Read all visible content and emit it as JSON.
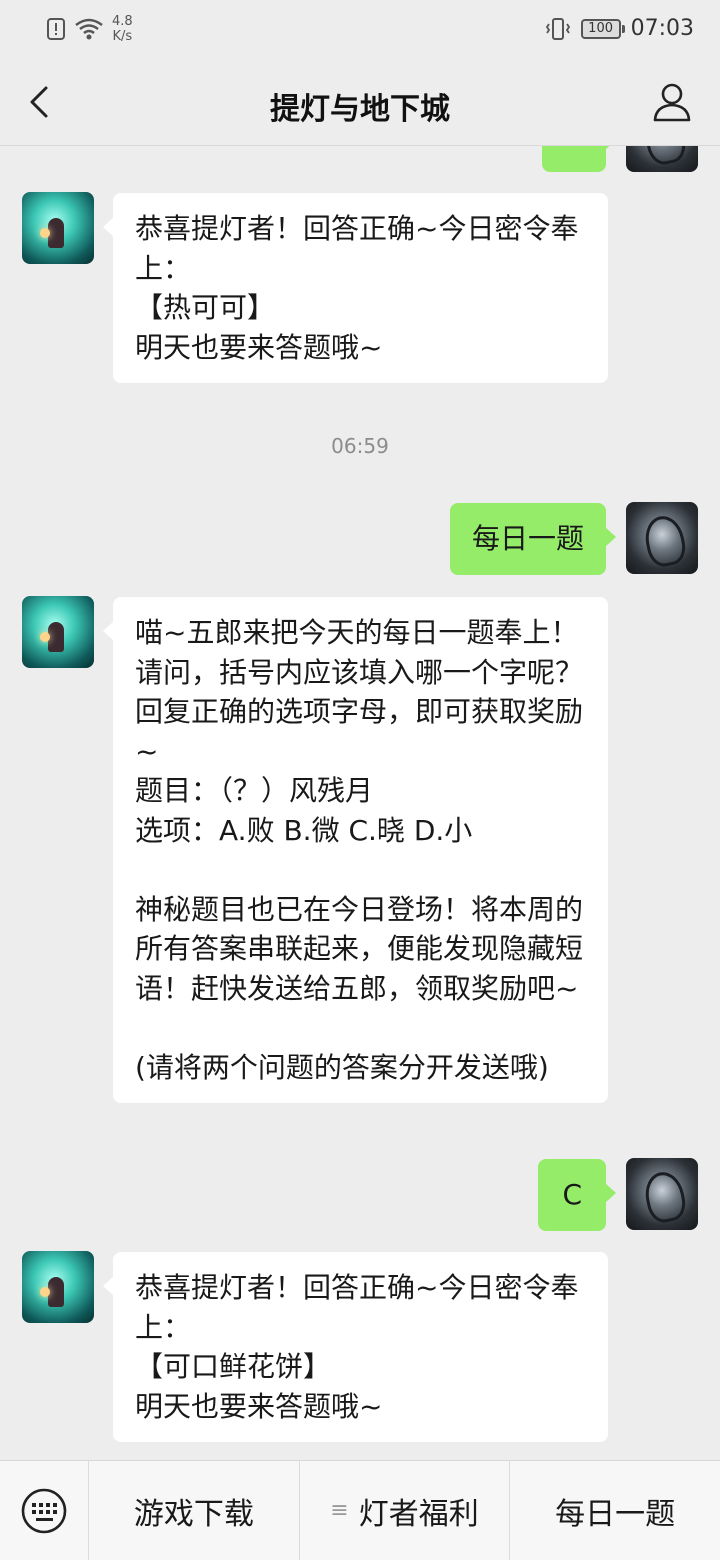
{
  "status_bar": {
    "network_speed_value": "4.8",
    "network_speed_unit": "K/s",
    "battery": "100",
    "time": "07:03",
    "icons": [
      "alert-icon",
      "wifi-icon",
      "vibrate-icon",
      "battery-icon"
    ]
  },
  "header": {
    "title": "提灯与地下城",
    "back_icon": "chevron-left-icon",
    "profile_icon": "person-icon"
  },
  "messages": [
    {
      "from": "bot",
      "text": "恭喜提灯者！回答正确~今日密令奉上：\n【热可可】\n明天也要来答题哦~"
    },
    {
      "type": "timestamp",
      "text": "06:59"
    },
    {
      "from": "user",
      "text": "每日一题"
    },
    {
      "from": "bot",
      "text": "喵~五郎来把今天的每日一题奉上！请问，括号内应该填入哪一个字呢？回复正确的选项字母，即可获取奖励~\n题目：（？）风残月\n选项：A.败 B.微 C.晓 D.小\n\n神秘题目也已在今日登场！将本周的所有答案串联起来，便能发现隐藏短语！赶快发送给五郎，领取奖励吧~\n\n(请将两个问题的答案分开发送哦)"
    },
    {
      "from": "user",
      "text": "C"
    },
    {
      "from": "bot",
      "text": "恭喜提灯者！回答正确~今日密令奉上：\n【可口鲜花饼】\n明天也要来答题哦~"
    }
  ],
  "bottom_menu": {
    "keyboard_icon": "keyboard-icon",
    "items": [
      {
        "label": "游戏下载"
      },
      {
        "label": "灯者福利",
        "icon": "menu-lines-icon"
      },
      {
        "label": "每日一题"
      }
    ]
  },
  "colors": {
    "background": "#ededed",
    "incoming_bubble": "#ffffff",
    "outgoing_bubble": "#95ec69",
    "timestamp_text": "#8c8c8c"
  }
}
